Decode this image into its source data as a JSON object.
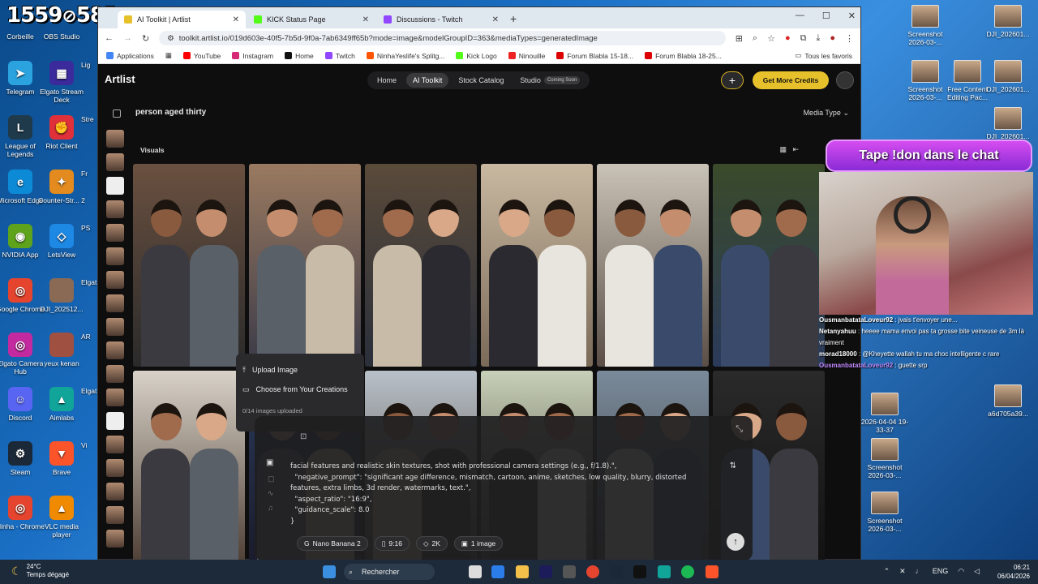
{
  "overlay": {
    "viewer_count": "1559",
    "viewer_count2": "585"
  },
  "desktop_left": [
    {
      "label": "Corbeille",
      "color": "#6a7a8a",
      "glyph": "🗑"
    },
    {
      "label": "OBS Studio",
      "color": "#222",
      "glyph": "●"
    },
    {
      "label": "Telegram",
      "color": "#2aa3df",
      "glyph": "➤"
    },
    {
      "label": "Elgato Stream Deck",
      "color": "#3b2a9c",
      "glyph": "▦"
    },
    {
      "label": "League of Legends",
      "color": "#1f3a4a",
      "glyph": "L"
    },
    {
      "label": "Riot Client",
      "color": "#e0313b",
      "glyph": "✊"
    },
    {
      "label": "Microsoft Edge",
      "color": "#0d8ad6",
      "glyph": "e"
    },
    {
      "label": "Counter-Str... 2",
      "color": "#e38b1e",
      "glyph": "✦"
    },
    {
      "label": "NVIDIA App",
      "color": "#5ea31b",
      "glyph": "◉"
    },
    {
      "label": "LetsView",
      "color": "#1e88e5",
      "glyph": "◇"
    },
    {
      "label": "Google Chrome",
      "color": "#e5452f",
      "glyph": "◎"
    },
    {
      "label": "DJI_202512...",
      "color": "#8a6a55",
      "glyph": ""
    },
    {
      "label": "Elgato Camera Hub",
      "color": "#c42aa0",
      "glyph": "◎"
    },
    {
      "label": "yeux kenan",
      "color": "#a05040",
      "glyph": ""
    },
    {
      "label": "Discord",
      "color": "#5865f2",
      "glyph": "☺"
    },
    {
      "label": "Aimlabs",
      "color": "#11a59a",
      "glyph": "▲"
    },
    {
      "label": "Steam",
      "color": "#1b2838",
      "glyph": "⚙"
    },
    {
      "label": "Brave",
      "color": "#fb542b",
      "glyph": "▼"
    },
    {
      "label": "Ninha - Chrome",
      "color": "#e5452f",
      "glyph": "◎"
    },
    {
      "label": "VLC media player",
      "color": "#f08a00",
      "glyph": "▲"
    }
  ],
  "desktop_left_partial": [
    "Lig",
    "Stre",
    "Fr",
    "PS",
    "Elgat",
    "AR",
    "Elgat",
    "Vi"
  ],
  "desktop_right": [
    {
      "label": "Screenshot 2026-03-..."
    },
    {
      "label": "DJI_202601..."
    },
    {
      "label": "Screenshot 2026-03-..."
    },
    {
      "label": "Free Content Editing Pac..."
    },
    {
      "label": "DJI_202601..."
    },
    {
      "label": "DJI_202601..."
    },
    {
      "label": "2026-04-04 19-33-37"
    },
    {
      "label": "a6d705a39..."
    },
    {
      "label": "Screenshot 2026-03-..."
    },
    {
      "label": "Screenshot 2026-03-..."
    }
  ],
  "browser": {
    "tabs": [
      {
        "title": "AI Toolkit | Artlist",
        "color": "#e7c12c"
      },
      {
        "title": "KICK Status Page",
        "color": "#53fc18"
      },
      {
        "title": "Discussions - Twitch",
        "color": "#9146ff"
      }
    ],
    "url": "toolkit.artlist.io/019d603e-40f5-7b5d-9f0a-7ab6349ff65b?mode=image&modelGroupID=363&mediaTypes=generatedImage",
    "bookmarks": [
      {
        "label": "Applications",
        "color": "#4285f4"
      },
      {
        "label": "YouTube",
        "color": "#ff0000"
      },
      {
        "label": "Instagram",
        "color": "#d62976"
      },
      {
        "label": "Home",
        "color": "#111111"
      },
      {
        "label": "Twitch",
        "color": "#9146ff"
      },
      {
        "label": "NinhaYeslife's Splitg...",
        "color": "#ff5500"
      },
      {
        "label": "Kick Logo",
        "color": "#53fc18"
      },
      {
        "label": "Ninouille",
        "color": "#e22"
      },
      {
        "label": "Forum Blabla 15-18...",
        "color": "#d00"
      },
      {
        "label": "Forum Blabla 18-25...",
        "color": "#d00"
      }
    ],
    "all_bookmarks": "Tous les favoris"
  },
  "app": {
    "logo": "Artlist",
    "nav": [
      "Home",
      "AI Toolkit",
      "Stock Catalog",
      "Studio"
    ],
    "coming_soon": "Coming Soon",
    "credits_button": "Get More Credits",
    "prompt_title": "person aged thirty",
    "media_type": "Media Type",
    "visuals_label": "Visuals",
    "upload": {
      "upload_image": "Upload Image",
      "choose_creations": "Choose from Your Creations",
      "count": "0/14 images uploaded"
    },
    "prompt_text": "facial features and realistic skin textures, shot with professional camera settings (e.g., f/1.8).\",\n  \"negative_prompt\": \"significant age difference, mismatch, cartoon, anime, sketches, low quality, blurry, distorted features, extra limbs, 3d render, watermarks, text.\",\n  \"aspect_ratio\": \"16:9\",\n  \"guidance_scale\": 8.0\n}",
    "chips": [
      "Nano Banana 2",
      "9:16",
      "2K",
      "1 image"
    ]
  },
  "stream": {
    "banner": "Tape !don dans le chat",
    "chat": [
      {
        "user": "OusmanbatataLoveur92",
        "msg": "jvais t'envoyer une...",
        "style": "cu1"
      },
      {
        "user": "Netanyahuu",
        "msg": "heeee mama envoi pas ta grosse bite veineuse de 3m là vraiment",
        "style": "cu1"
      },
      {
        "user": "morad18000",
        "msg": "@Kheyette wallah tu ma choc intelligente c rare",
        "style": "cu1"
      },
      {
        "user": "OusmanbatataLoveur92",
        "msg": "guette srp",
        "style": "cu2"
      }
    ]
  },
  "taskbar": {
    "temp": "24°C",
    "weather": "Temps dégagé",
    "search": "Rechercher",
    "lang": "ENG",
    "time": "06:21",
    "date": "06/04/2026"
  }
}
